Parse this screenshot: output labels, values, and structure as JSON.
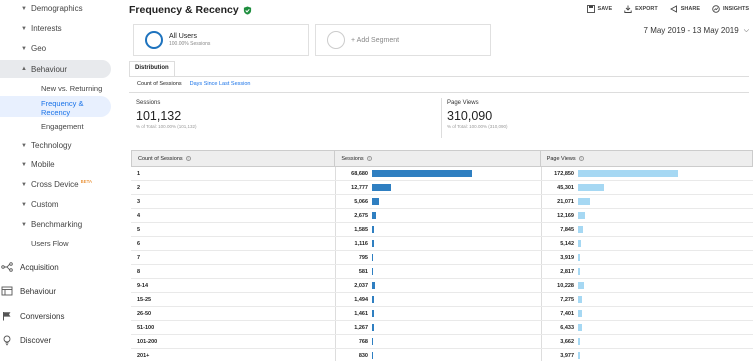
{
  "sidebar": {
    "items": [
      {
        "label": "Demographics"
      },
      {
        "label": "Interests"
      },
      {
        "label": "Geo"
      },
      {
        "label": "Behaviour"
      },
      {
        "label": "New vs. Returning"
      },
      {
        "label": "Frequency & Recency"
      },
      {
        "label": "Engagement"
      },
      {
        "label": "Technology"
      },
      {
        "label": "Mobile"
      },
      {
        "label": "Cross Device",
        "badge": "BETA"
      },
      {
        "label": "Custom"
      },
      {
        "label": "Benchmarking"
      },
      {
        "label": "Users Flow"
      }
    ],
    "sections": [
      {
        "label": "Acquisition",
        "icon": "acquisition-icon"
      },
      {
        "label": "Behaviour",
        "icon": "behaviour-icon"
      },
      {
        "label": "Conversions",
        "icon": "flag-icon"
      },
      {
        "label": "Discover",
        "icon": "lightbulb-icon"
      }
    ]
  },
  "header": {
    "title": "Frequency & Recency",
    "actions": {
      "save": "SAVE",
      "export": "EXPORT",
      "share": "SHARE",
      "insights": "INSIGHTS"
    }
  },
  "segments": {
    "active": {
      "name": "All Users",
      "pct": "100.00% Sessions"
    },
    "add": "+ Add Segment"
  },
  "date_range": "7 May 2019 - 13 May 2019",
  "tabs": {
    "distribution": "Distribution"
  },
  "subtabs": {
    "count": "Count of Sessions",
    "days": "Days Since Last Session"
  },
  "metrics": {
    "sessions": {
      "label": "Sessions",
      "value": "101,132",
      "sub": "% of Total: 100.00% (101,132)"
    },
    "pageviews": {
      "label": "Page Views",
      "value": "310,090",
      "sub": "% of Total: 100.00% (310,090)"
    }
  },
  "table": {
    "headers": {
      "count": "Count of Sessions",
      "sessions": "Sessions",
      "pageviews": "Page Views"
    },
    "rows": [
      {
        "count": "1",
        "sessions": "68,680",
        "pageviews": "172,850"
      },
      {
        "count": "2",
        "sessions": "12,777",
        "pageviews": "45,301"
      },
      {
        "count": "3",
        "sessions": "5,066",
        "pageviews": "21,071"
      },
      {
        "count": "4",
        "sessions": "2,675",
        "pageviews": "12,169"
      },
      {
        "count": "5",
        "sessions": "1,585",
        "pageviews": "7,845"
      },
      {
        "count": "6",
        "sessions": "1,116",
        "pageviews": "5,142"
      },
      {
        "count": "7",
        "sessions": "795",
        "pageviews": "3,919"
      },
      {
        "count": "8",
        "sessions": "581",
        "pageviews": "2,817"
      },
      {
        "count": "9-14",
        "sessions": "2,037",
        "pageviews": "10,228"
      },
      {
        "count": "15-25",
        "sessions": "1,494",
        "pageviews": "7,275"
      },
      {
        "count": "26-50",
        "sessions": "1,461",
        "pageviews": "7,401"
      },
      {
        "count": "51-100",
        "sessions": "1,267",
        "pageviews": "6,433"
      },
      {
        "count": "101-200",
        "sessions": "768",
        "pageviews": "3,662"
      },
      {
        "count": "201+",
        "sessions": "830",
        "pageviews": "3,977"
      }
    ]
  },
  "colors": {
    "accent": "#1a73e8",
    "sessions_bar": "#2f7fc1",
    "pageviews_bar": "#a6d8f3",
    "verified": "#1e8e3e",
    "beta": "#e37400"
  }
}
